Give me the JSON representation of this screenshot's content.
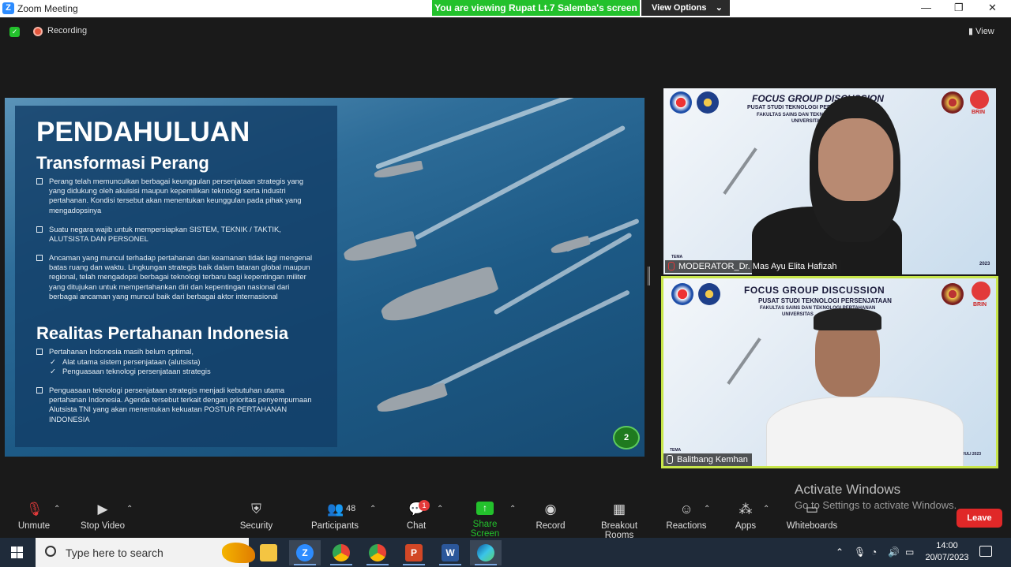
{
  "window": {
    "title": "Zoom Meeting",
    "app_icon": "zoom-icon",
    "controls": [
      "minimize-icon",
      "restore-icon",
      "close-icon"
    ]
  },
  "share_banner": {
    "text": "You are viewing Rupat Lt.7 Salemba's screen",
    "view_options": "View Options",
    "color": "#23c12c"
  },
  "meeting_bar": {
    "recording": "Recording",
    "view": "View"
  },
  "slide": {
    "title": "PENDAHULUAN",
    "section1": "Transformasi Perang",
    "bullets1": [
      "Perang telah memunculkan berbagai keunggulan persenjataan strategis yang yang didukung oleh akuisisi maupun kepemilikan teknologi serta industri pertahanan. Kondisi tersebut akan menentukan keunggulan pada pihak yang mengadopsinya",
      "Suatu negara wajib untuk mempersiapkan SISTEM, TEKNIK / TAKTIK, ALUTSISTA DAN PERSONEL",
      "Ancaman yang muncul terhadap pertahanan dan keamanan tidak lagi mengenal batas ruang dan waktu. Lingkungan strategis baik dalam tataran global maupun regional, telah mengadopsi berbagai teknologi terbaru bagi kepentingan militer yang ditujukan untuk mempertahankan diri dan kepentingan nasional dari berbagai ancaman yang muncul baik dari berbagai aktor internasional"
    ],
    "section2": "Realitas Pertahanan Indonesia",
    "bullet2a": "Pertahanan Indonesia masih belum optimal,",
    "sub_items": [
      "Alat utama sistem persenjataan (alutsista)",
      "Penguasaan teknologi persenjataan strategis"
    ],
    "bullet2b": "Penguasaan teknologi persenjataan strategis menjadi kebutuhan utama pertahanan Indonesia. Agenda tersebut terkait dengan prioritas penyempurnaan Alutsista TNI yang akan menentukan kekuatan POSTUR PERTAHANAN INDONESIA",
    "page_number": "2"
  },
  "participants_video": [
    {
      "banner_title": "FOCUS GROUP DISCUSSION",
      "banner_sub1": "PUSAT STUDI TEKNOLOGI PERSENJATAAN",
      "banner_sub2": "FAKULTAS SAINS DAN TEKNOLOGI PERTAHANAN",
      "banner_sub3": "UNIVERSITAS",
      "brin": "BRIN",
      "tema": "TEMA",
      "year": "2023",
      "name": "MODERATOR_Dr. Mas Ayu Elita Hafizah",
      "muted": true
    },
    {
      "banner_title": "FOCUS GROUP DISCUSSION",
      "banner_sub1": "PUSAT STUDI TEKNOLOGI PERSENJATAAN",
      "banner_sub2": "FAKULTAS SAINS DAN TEKNOLOGI PERTAHANAN",
      "banner_sub3": "UNIVERSITAS",
      "banner_sub3_tail": "RI",
      "brin": "BRIN",
      "tema": "TEMA",
      "date_text": "SA, 25 JULI 2023",
      "name": "Balitbang Kemhan",
      "muted": false,
      "active_speaker_color": "#c8e64a"
    }
  ],
  "watermark": {
    "line1": "Activate Windows",
    "line2": "Go to Settings to activate Windows."
  },
  "toolbar": {
    "unmute": "Unmute",
    "stop_video": "Stop Video",
    "security": "Security",
    "participants": "Participants",
    "participants_count": "48",
    "chat": "Chat",
    "chat_badge": "1",
    "share_screen": "Share Screen",
    "record": "Record",
    "breakout_rooms": "Breakout Rooms",
    "reactions": "Reactions",
    "apps": "Apps",
    "whiteboards": "Whiteboards",
    "leave": "Leave"
  },
  "taskbar": {
    "search_placeholder": "Type here to search",
    "apps": [
      "file-explorer-icon",
      "zoom-icon",
      "chrome-icon",
      "chrome-icon",
      "powerpoint-icon",
      "word-icon",
      "edge-icon"
    ],
    "time": "14:00",
    "date": "20/07/2023"
  }
}
